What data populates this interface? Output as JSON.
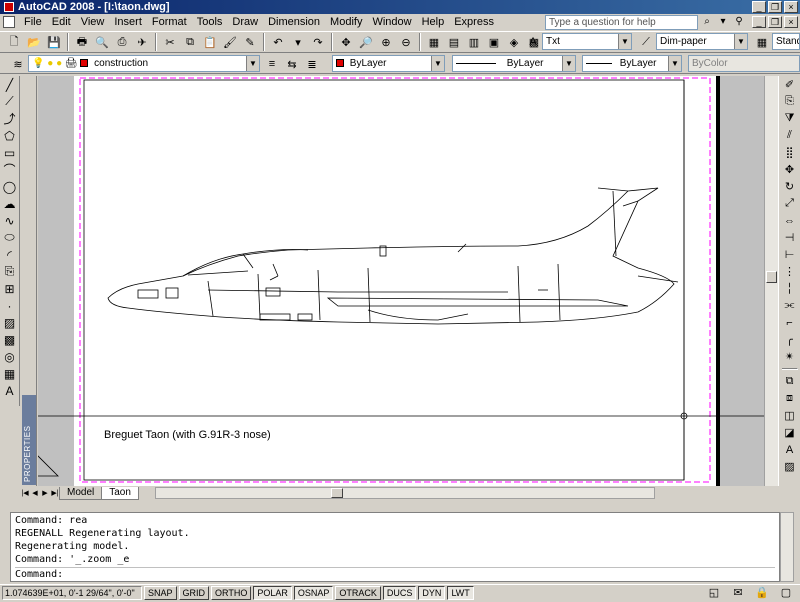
{
  "title": "AutoCAD 2008 - [I:\\taon.dwg]",
  "menu": [
    "File",
    "Edit",
    "View",
    "Insert",
    "Format",
    "Tools",
    "Draw",
    "Dimension",
    "Modify",
    "Window",
    "Help",
    "Express"
  ],
  "help_placeholder": "Type a question for help",
  "styles": {
    "text_style": "Txt",
    "dim_style": "Dim-paper",
    "table_style": "Standa"
  },
  "layers": {
    "current_layer": "construction",
    "color": "ByLayer",
    "linetype": "ByLayer",
    "lineweight": "ByLayer",
    "plotstyle": "ByColor"
  },
  "drawing": {
    "caption": "Breguet Taon (with G.91R-3 nose)"
  },
  "side_label": "PROPERTIES",
  "layout_tabs": [
    "Model",
    "Taon"
  ],
  "active_tab": "Taon",
  "command_lines": [
    "Command: rea",
    "REGENALL Regenerating layout.",
    "Regenerating model.",
    "Command: '_.zoom _e"
  ],
  "command_prompt": "Command:",
  "status": {
    "coords": "1.074639E+01, 0'-1 29/64\", 0'-0\"",
    "buttons": [
      "SNAP",
      "GRID",
      "ORTHO",
      "POLAR",
      "OSNAP",
      "OTRACK",
      "DUCS",
      "DYN",
      "LWT"
    ],
    "active_buttons": [
      "POLAR",
      "OSNAP",
      "DUCS",
      "DYN",
      "LWT"
    ]
  },
  "colors": {
    "title_start": "#0a246a",
    "title_end": "#3a6ea5",
    "chrome": "#d4d0c8",
    "paper_margin": "#ff00ff",
    "layer_swatch": "#e00000"
  }
}
